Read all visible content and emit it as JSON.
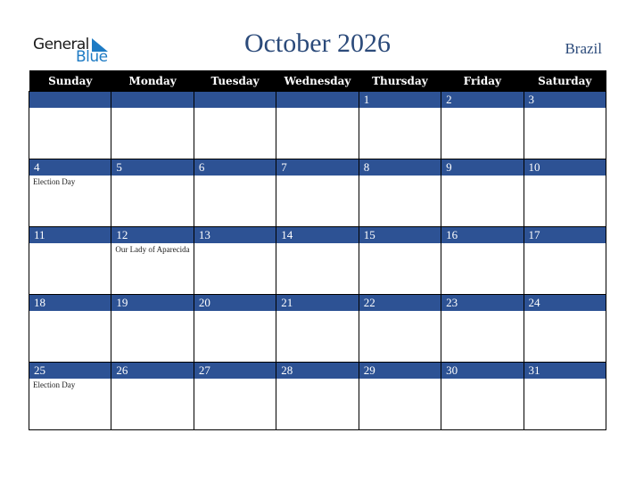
{
  "logo": {
    "word1": "General",
    "word2": "Blue",
    "icon": "triangle-logo-icon"
  },
  "title": "October 2026",
  "country": "Brazil",
  "colors": {
    "header_bg": "#000000",
    "day_bar": "#2d5294",
    "title": "#2b4a7a",
    "logo_blue": "#1e7bc4"
  },
  "weekdays": [
    "Sunday",
    "Monday",
    "Tuesday",
    "Wednesday",
    "Thursday",
    "Friday",
    "Saturday"
  ],
  "weeks": [
    [
      {
        "d": "",
        "e": ""
      },
      {
        "d": "",
        "e": ""
      },
      {
        "d": "",
        "e": ""
      },
      {
        "d": "",
        "e": ""
      },
      {
        "d": "1",
        "e": ""
      },
      {
        "d": "2",
        "e": ""
      },
      {
        "d": "3",
        "e": ""
      }
    ],
    [
      {
        "d": "4",
        "e": "Election Day"
      },
      {
        "d": "5",
        "e": ""
      },
      {
        "d": "6",
        "e": ""
      },
      {
        "d": "7",
        "e": ""
      },
      {
        "d": "8",
        "e": ""
      },
      {
        "d": "9",
        "e": ""
      },
      {
        "d": "10",
        "e": ""
      }
    ],
    [
      {
        "d": "11",
        "e": ""
      },
      {
        "d": "12",
        "e": "Our Lady of Aparecida"
      },
      {
        "d": "13",
        "e": ""
      },
      {
        "d": "14",
        "e": ""
      },
      {
        "d": "15",
        "e": ""
      },
      {
        "d": "16",
        "e": ""
      },
      {
        "d": "17",
        "e": ""
      }
    ],
    [
      {
        "d": "18",
        "e": ""
      },
      {
        "d": "19",
        "e": ""
      },
      {
        "d": "20",
        "e": ""
      },
      {
        "d": "21",
        "e": ""
      },
      {
        "d": "22",
        "e": ""
      },
      {
        "d": "23",
        "e": ""
      },
      {
        "d": "24",
        "e": ""
      }
    ],
    [
      {
        "d": "25",
        "e": "Election Day"
      },
      {
        "d": "26",
        "e": ""
      },
      {
        "d": "27",
        "e": ""
      },
      {
        "d": "28",
        "e": ""
      },
      {
        "d": "29",
        "e": ""
      },
      {
        "d": "30",
        "e": ""
      },
      {
        "d": "31",
        "e": ""
      }
    ]
  ]
}
